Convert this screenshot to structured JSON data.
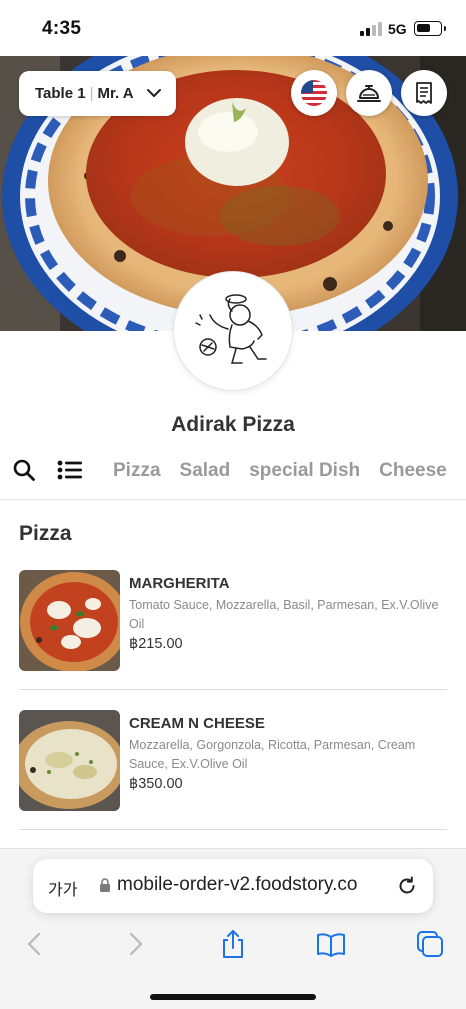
{
  "status_bar": {
    "time": "4:35",
    "network": "5G",
    "battery_level": 0.6
  },
  "header": {
    "table_label": "Table 1",
    "customer_label": "Mr. A",
    "icons": [
      "flag-us-icon",
      "service-bell-icon",
      "receipt-icon"
    ]
  },
  "restaurant": {
    "name": "Adirak Pizza"
  },
  "category_bar": {
    "icons": [
      "search-icon",
      "list-icon"
    ],
    "tabs": [
      "Pizza",
      "Salad",
      "special Dish",
      "Cheese"
    ]
  },
  "menu": {
    "section_title": "Pizza",
    "items": [
      {
        "name": "MARGHERITA",
        "description": "Tomato Sauce, Mozzarella, Basil, Parmesan, Ex.V.Olive Oil",
        "price": "฿215.00"
      },
      {
        "name": "CREAM N CHEESE",
        "description": "Mozzarella, Gorgonzola, Ricotta, Parmesan, Cream Sauce, Ex.V.Olive Oil",
        "price": "฿350.00"
      }
    ]
  },
  "browser": {
    "text_size_label": "가가",
    "url": "mobile-order-v2.foodstory.co"
  },
  "colors": {
    "accent_blue": "#1a73e8",
    "text_dark": "#333333",
    "text_muted": "#8a8a8a",
    "tab_inactive": "#9a9a9a"
  }
}
